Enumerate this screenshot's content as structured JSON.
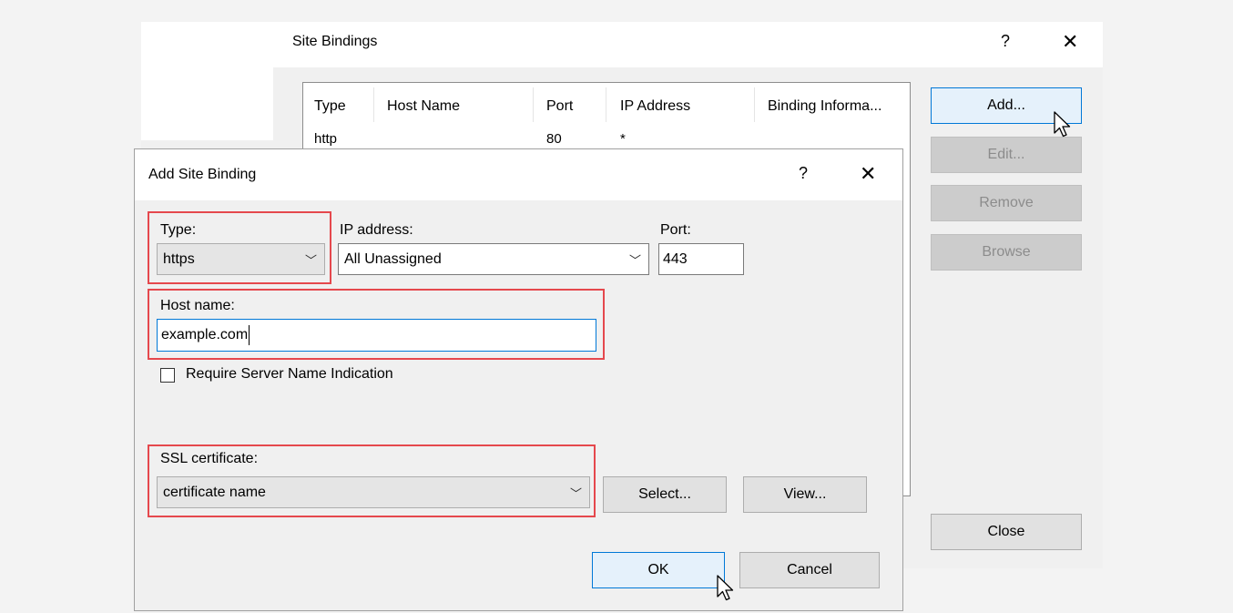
{
  "site_bindings": {
    "title": "Site Bindings",
    "help_glyph": "?",
    "close_glyph": "✕",
    "columns": [
      "Type",
      "Host Name",
      "Port",
      "IP Address",
      "Binding Informa..."
    ],
    "rows": [
      {
        "type": "http",
        "host_name": "",
        "port": "80",
        "ip_address": "*",
        "binding_info": ""
      }
    ],
    "buttons": {
      "add": "Add...",
      "edit": "Edit...",
      "remove": "Remove",
      "browse": "Browse",
      "close": "Close"
    }
  },
  "add_site_binding": {
    "title": "Add Site Binding",
    "help_glyph": "?",
    "close_glyph": "✕",
    "type_label": "Type:",
    "type_value": "https",
    "ip_label": "IP address:",
    "ip_value": "All Unassigned",
    "port_label": "Port:",
    "port_value": "443",
    "host_label": "Host name:",
    "host_value": "example.com",
    "sni_label": "Require Server Name Indication",
    "sni_checked": false,
    "ssl_label": "SSL certificate:",
    "ssl_value": "certificate name",
    "select_button": "Select...",
    "view_button": "View...",
    "ok_button": "OK",
    "cancel_button": "Cancel",
    "chevron_glyph": "﹀"
  },
  "colors": {
    "highlight": "#e5484d",
    "focus_blue": "#0078d7",
    "primary_button_bg": "#e5f1fb"
  }
}
